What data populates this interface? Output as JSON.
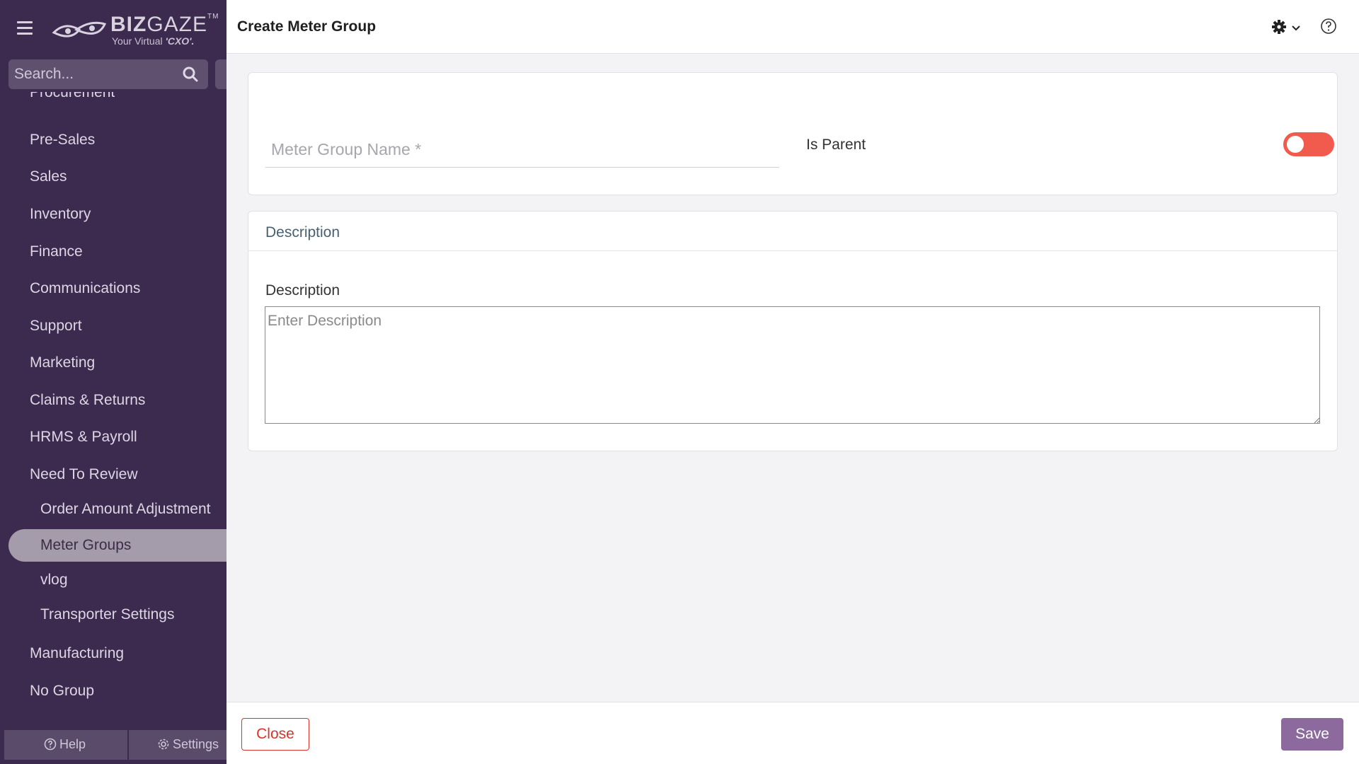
{
  "sidebar": {
    "logo": {
      "brand_bold": "BIZ",
      "brand_light": "GAZE",
      "trademark": "TM",
      "tagline_prefix": "Your Virtual",
      "tagline_bold": "'CXO'."
    },
    "search": {
      "placeholder": "Search..."
    },
    "partial_item": "Procurement",
    "items": [
      {
        "label": "Pre-Sales"
      },
      {
        "label": "Sales"
      },
      {
        "label": "Inventory"
      },
      {
        "label": "Finance"
      },
      {
        "label": "Communications"
      },
      {
        "label": "Support"
      },
      {
        "label": "Marketing"
      },
      {
        "label": "Claims & Returns"
      },
      {
        "label": "HRMS & Payroll"
      },
      {
        "label": "Need To Review"
      }
    ],
    "sub_items": [
      {
        "label": "Order Amount Adjustment"
      },
      {
        "label": "Meter Groups"
      },
      {
        "label": "vlog"
      },
      {
        "label": "Transporter Settings"
      }
    ],
    "bottom_items": [
      {
        "label": "Manufacturing"
      },
      {
        "label": "No Group"
      }
    ],
    "footer": {
      "help": "Help",
      "settings": "Settings"
    }
  },
  "header": {
    "title": "Create Meter Group"
  },
  "form": {
    "name_placeholder": "Meter Group Name *",
    "is_parent_label": "Is Parent",
    "is_parent_on": false,
    "description_section_title": "Description",
    "description_label": "Description",
    "description_placeholder": "Enter Description"
  },
  "footer": {
    "close_label": "Close",
    "save_label": "Save"
  },
  "colors": {
    "sidebar": "#3d2a4f",
    "accent": "#8c6a9e",
    "danger": "#d9342b",
    "toggle": "#f15b4e"
  }
}
